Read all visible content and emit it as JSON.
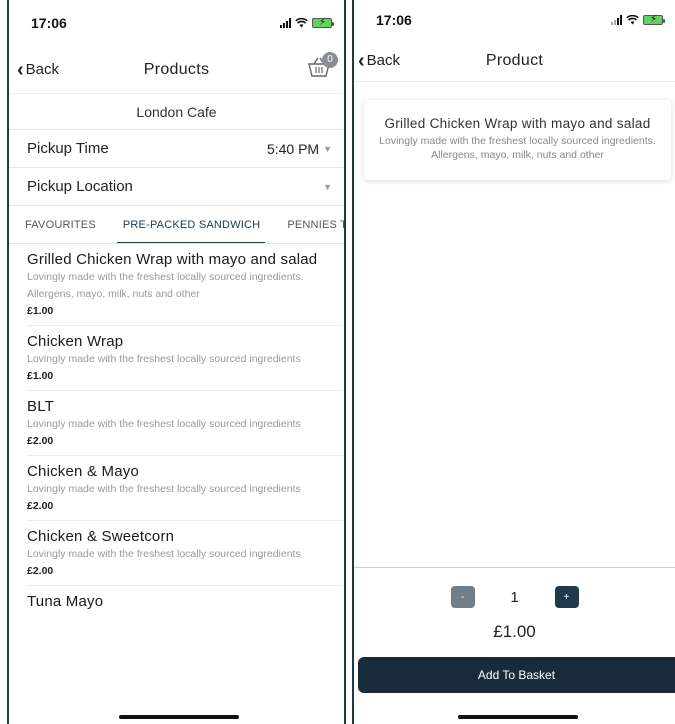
{
  "left_screen": {
    "status_time": "17:06",
    "nav": {
      "back_label": "Back",
      "title": "Products",
      "basket_count": "0"
    },
    "cafe_name": "London Cafe",
    "pickup_time": {
      "label": "Pickup Time",
      "value": "5:40 PM"
    },
    "pickup_location": {
      "label": "Pickup Location",
      "value": ""
    },
    "tabs": [
      {
        "label": "FAVOURITES"
      },
      {
        "label": "PRE-PACKED SANDWICH"
      },
      {
        "label": "PENNIES TR"
      }
    ],
    "active_tab": "PRE-PACKED SANDWICH",
    "products": [
      {
        "name": "Grilled Chicken Wrap with mayo and salad",
        "desc": "Lovingly made with the freshest locally sourced ingredients. Allergens, mayo, milk, nuts and other",
        "price": "£1.00"
      },
      {
        "name": "Chicken Wrap",
        "desc": "Lovingly made with the freshest locally sourced ingredients",
        "price": "£1.00"
      },
      {
        "name": "BLT",
        "desc": "Lovingly made with the freshest locally sourced ingredients",
        "price": "£2.00"
      },
      {
        "name": "Chicken & Mayo",
        "desc": "Lovingly made with the freshest locally sourced ingredients",
        "price": "£2.00"
      },
      {
        "name": "Chicken & Sweetcorn",
        "desc": "Lovingly made with the freshest locally sourced ingredients",
        "price": "£2.00"
      },
      {
        "name": "Tuna Mayo",
        "desc": "",
        "price": ""
      }
    ]
  },
  "right_screen": {
    "status_time": "17:06",
    "nav": {
      "back_label": "Back",
      "title": "Product"
    },
    "product": {
      "name": "Grilled Chicken Wrap with mayo and salad",
      "desc": "Lovingly made with the freshest locally sourced ingredients. Allergens, mayo, milk, nuts and other"
    },
    "quantity": {
      "minus_label": "-",
      "value": "1",
      "plus_label": "+"
    },
    "price": "£1.00",
    "add_button_label": "Add To Basket"
  },
  "colors": {
    "primary": "#1f3a4d",
    "button_dark": "#1a2b3b",
    "muted_text": "#9a9a9a",
    "minus_button": "#6f7e88",
    "battery_green": "#5fd35f"
  },
  "icons": [
    "signal-icon",
    "wifi-icon",
    "battery-icon",
    "back-chevron-icon",
    "basket-icon",
    "dropdown-caret-icon"
  ]
}
